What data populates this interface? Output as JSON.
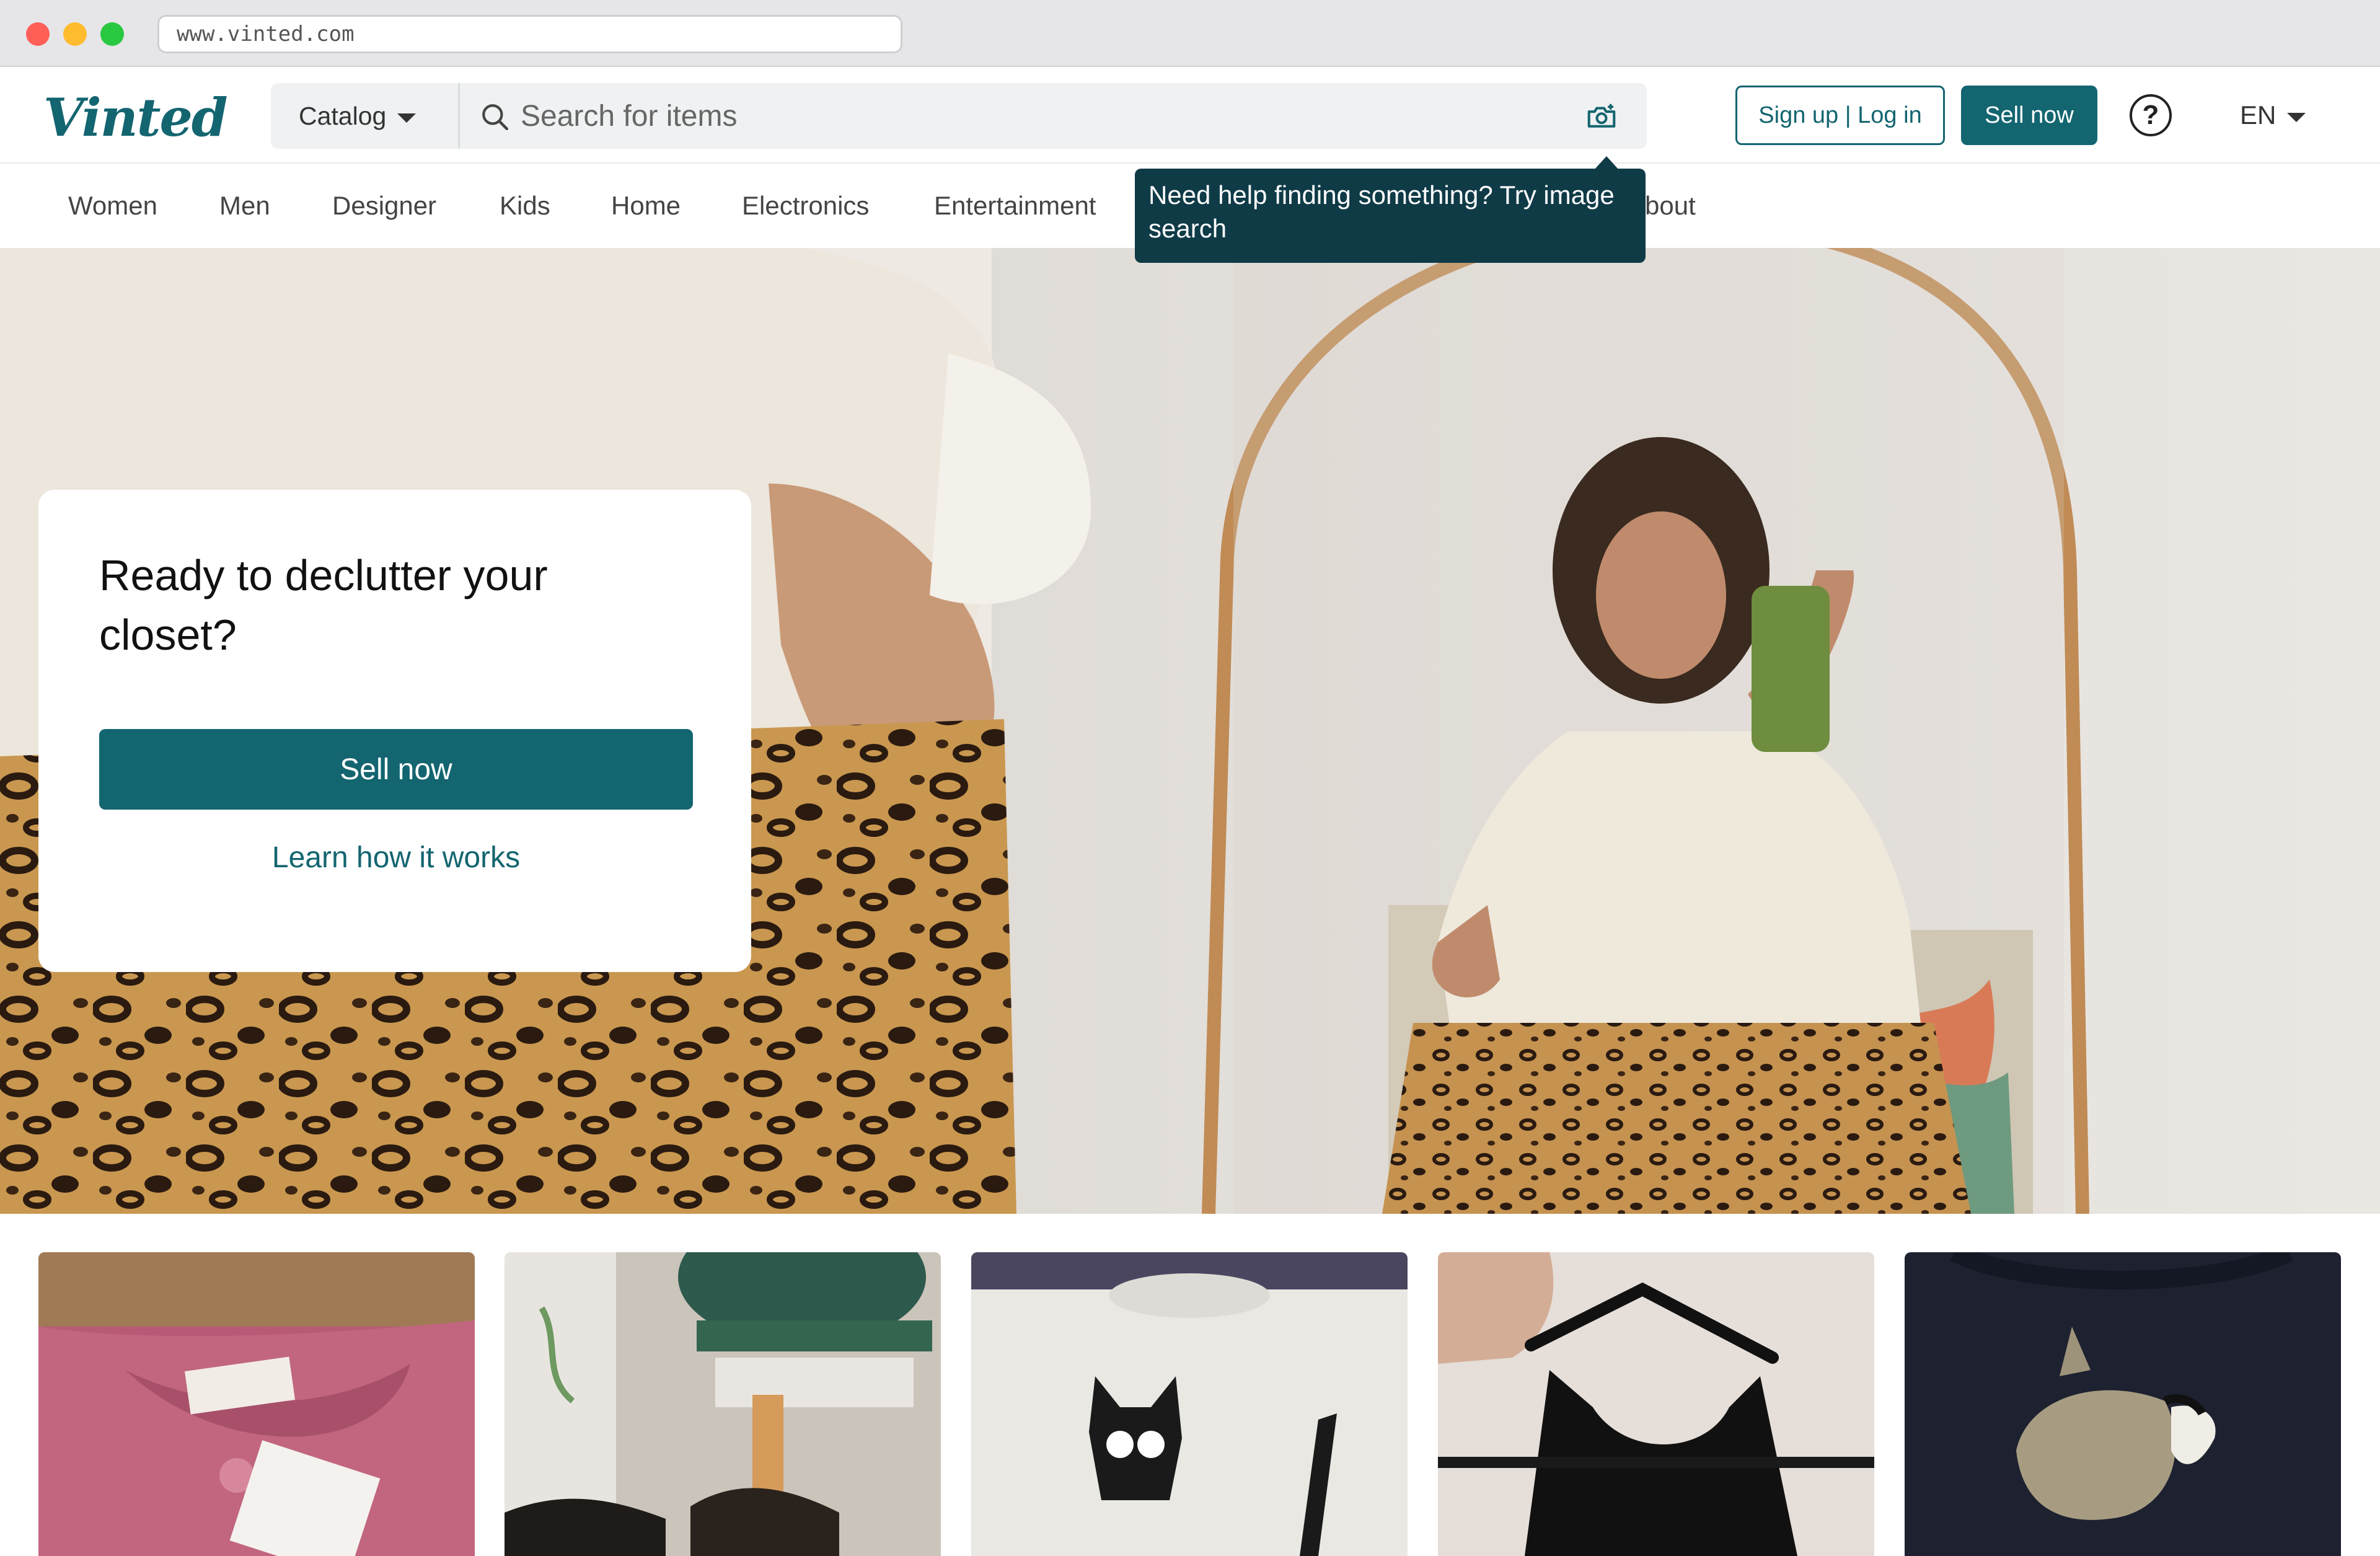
{
  "browser": {
    "url": "www.vinted.com"
  },
  "header": {
    "logo": "Vinted",
    "catalog_label": "Catalog",
    "search_placeholder": "Search for items",
    "signup_login_label": "Sign up | Log in",
    "sell_now_label": "Sell now",
    "help_symbol": "?",
    "language": "EN"
  },
  "nav": {
    "items": [
      "Women",
      "Men",
      "Designer",
      "Kids",
      "Home",
      "Electronics",
      "Entertainment",
      "About"
    ],
    "about_visible_fragment": "bout"
  },
  "tooltip": {
    "text": "Need help finding something? Try image search"
  },
  "hero": {
    "promo_title": "Ready to declutter your closet?",
    "promo_button": "Sell now",
    "promo_link": "Learn how it works"
  },
  "item_cards": [
    {
      "icon": "pink-knit-sweater-photo"
    },
    {
      "icon": "shoes-and-plant-photo"
    },
    {
      "icon": "cat-print-tshirt-photo"
    },
    {
      "icon": "black-top-on-hanger-photo"
    },
    {
      "icon": "cat-print-navy-shirt-photo"
    }
  ],
  "colors": {
    "brand": "#136570",
    "tooltip_bg": "#0f3b47"
  }
}
